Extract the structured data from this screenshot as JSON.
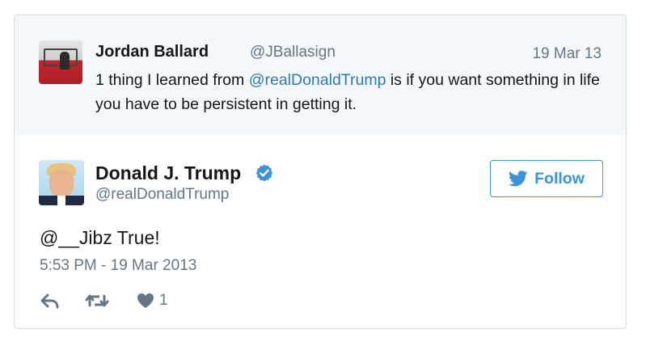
{
  "quoted_tweet": {
    "author_name": "Jordan Ballard",
    "handle": "@JBallasign",
    "date": "19 Mar 13",
    "text_before": "1 thing I learned from ",
    "mention": "@realDonaldTrump",
    "text_after": " is if you want something in life you have to be persistent in getting it."
  },
  "tweet": {
    "author_name": "Donald J. Trump",
    "handle": "@realDonaldTrump",
    "verified_icon": "verified-badge-icon",
    "text": "@__Jibz True!",
    "timestamp": "5:53 PM - 19 Mar 2013"
  },
  "follow_button": {
    "label": "Follow",
    "icon": "twitter-bird-icon"
  },
  "actions": {
    "reply_icon": "reply-icon",
    "retweet_icon": "retweet-icon",
    "like_icon": "heart-icon",
    "like_count": "1"
  },
  "colors": {
    "link": "#2b7bb9",
    "brand_blue": "#3b94d9",
    "muted": "#657786",
    "quoted_bg": "#f5f8fa"
  }
}
